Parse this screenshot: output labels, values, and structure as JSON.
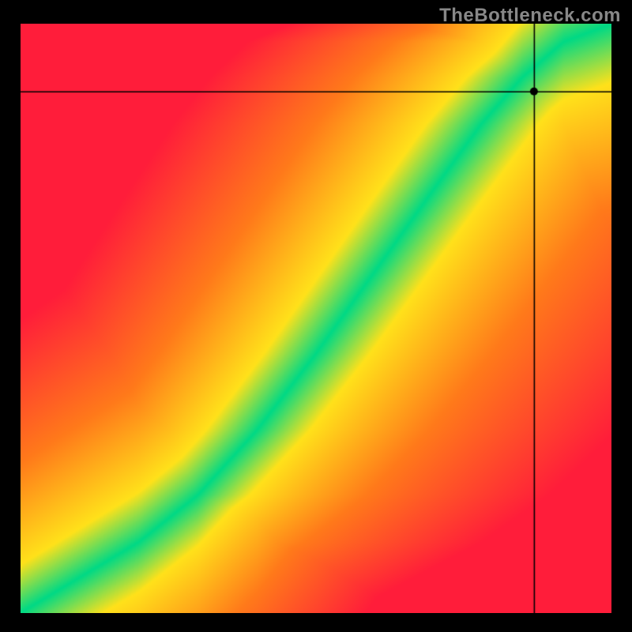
{
  "watermark": "TheBottleneck.com",
  "colors": {
    "red": "#ff1d3a",
    "orange": "#ff7a1a",
    "yellow": "#ffe11a",
    "green": "#00d985",
    "black": "#000000"
  },
  "chart_data": {
    "type": "heatmap",
    "title": "",
    "xlabel": "",
    "ylabel": "",
    "xlim": [
      0,
      1
    ],
    "ylim": [
      0,
      1
    ],
    "legend": "off",
    "grid": "off",
    "color_scale": {
      "description": "distance from optimal curve → color",
      "stops": [
        {
          "d": 0.0,
          "color_key": "green"
        },
        {
          "d": 0.09,
          "color_key": "yellow"
        },
        {
          "d": 0.28,
          "color_key": "orange"
        },
        {
          "d": 0.55,
          "color_key": "red"
        }
      ]
    },
    "optimal_curve": {
      "description": "green ridge y = f(x); piecewise-linear samples, normalized 0..1",
      "points": [
        {
          "x": 0.0,
          "y": 0.0
        },
        {
          "x": 0.1,
          "y": 0.06
        },
        {
          "x": 0.2,
          "y": 0.12
        },
        {
          "x": 0.3,
          "y": 0.2
        },
        {
          "x": 0.4,
          "y": 0.31
        },
        {
          "x": 0.5,
          "y": 0.44
        },
        {
          "x": 0.6,
          "y": 0.58
        },
        {
          "x": 0.7,
          "y": 0.72
        },
        {
          "x": 0.78,
          "y": 0.83
        },
        {
          "x": 0.85,
          "y": 0.91
        },
        {
          "x": 0.92,
          "y": 0.97
        },
        {
          "x": 1.0,
          "y": 1.0
        }
      ]
    },
    "marker": {
      "x": 0.87,
      "y": 0.885,
      "radius_px": 5
    },
    "crosshair": {
      "x": 0.87,
      "y": 0.885
    },
    "annotations": []
  }
}
